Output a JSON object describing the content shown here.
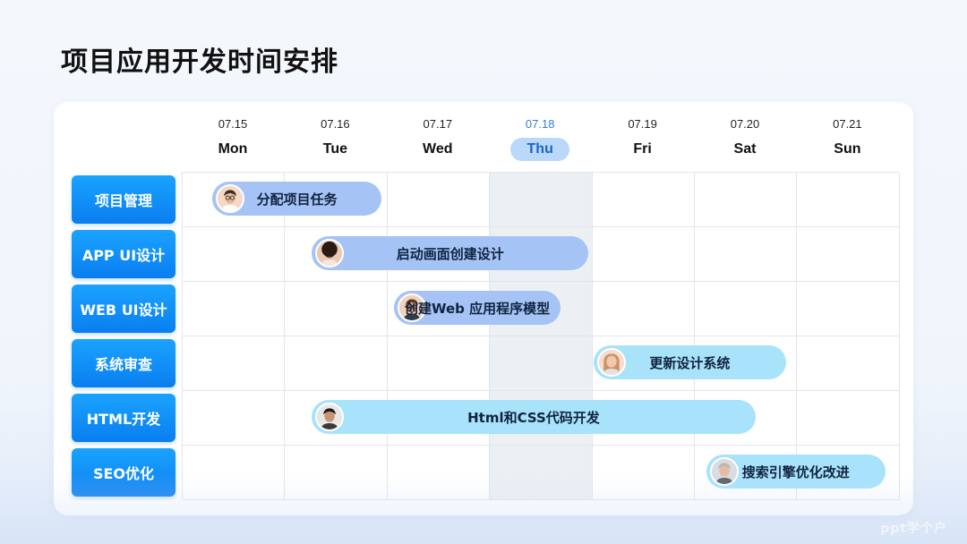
{
  "title": "项目应用开发时间安排",
  "days": [
    {
      "date": "07.15",
      "name": "Mon",
      "active": false
    },
    {
      "date": "07.16",
      "name": "Tue",
      "active": false
    },
    {
      "date": "07.17",
      "name": "Wed",
      "active": false
    },
    {
      "date": "07.18",
      "name": "Thu",
      "active": true
    },
    {
      "date": "07.19",
      "name": "Fri",
      "active": false
    },
    {
      "date": "07.20",
      "name": "Sat",
      "active": false
    },
    {
      "date": "07.21",
      "name": "Sun",
      "active": false
    }
  ],
  "rows": [
    {
      "label": "项目管理"
    },
    {
      "label": "APP UI设计"
    },
    {
      "label": "WEB UI设计"
    },
    {
      "label": "系统审查"
    },
    {
      "label": "HTML开发"
    },
    {
      "label": "SEO优化"
    }
  ],
  "tasks": [
    {
      "label": "分配项目任务",
      "row": 0,
      "start_day": 0.3,
      "end_day": 1.95,
      "color": "blue",
      "avatar": "avatar-man-glasses-icon"
    },
    {
      "label": "启动画面创建设计",
      "row": 1,
      "start_day": 1.27,
      "end_day": 3.97,
      "color": "blue",
      "avatar": "avatar-woman-curly-icon"
    },
    {
      "label": "创建Web 应用程序模型",
      "row": 2,
      "start_day": 2.07,
      "end_day": 3.7,
      "color": "blue",
      "avatar": "avatar-man-beard-icon"
    },
    {
      "label": "更新设计系统",
      "row": 3,
      "start_day": 4.02,
      "end_day": 5.9,
      "color": "cyan",
      "avatar": "avatar-woman-blonde-icon"
    },
    {
      "label": "Html和CSS代码开发",
      "row": 4,
      "start_day": 1.27,
      "end_day": 5.6,
      "color": "cyan",
      "avatar": "avatar-man-dark-icon"
    },
    {
      "label": "搜索引擎优化改进",
      "row": 5,
      "start_day": 5.12,
      "end_day": 6.87,
      "color": "cyan",
      "avatar": "avatar-man-bald-icon"
    }
  ],
  "watermark": "ppt学个户",
  "colors": {
    "accent": "#1aa3ff",
    "bar_blue": "#a5c3f5",
    "bar_cyan": "#a8e2fb",
    "active_day": "#2f7de0"
  }
}
